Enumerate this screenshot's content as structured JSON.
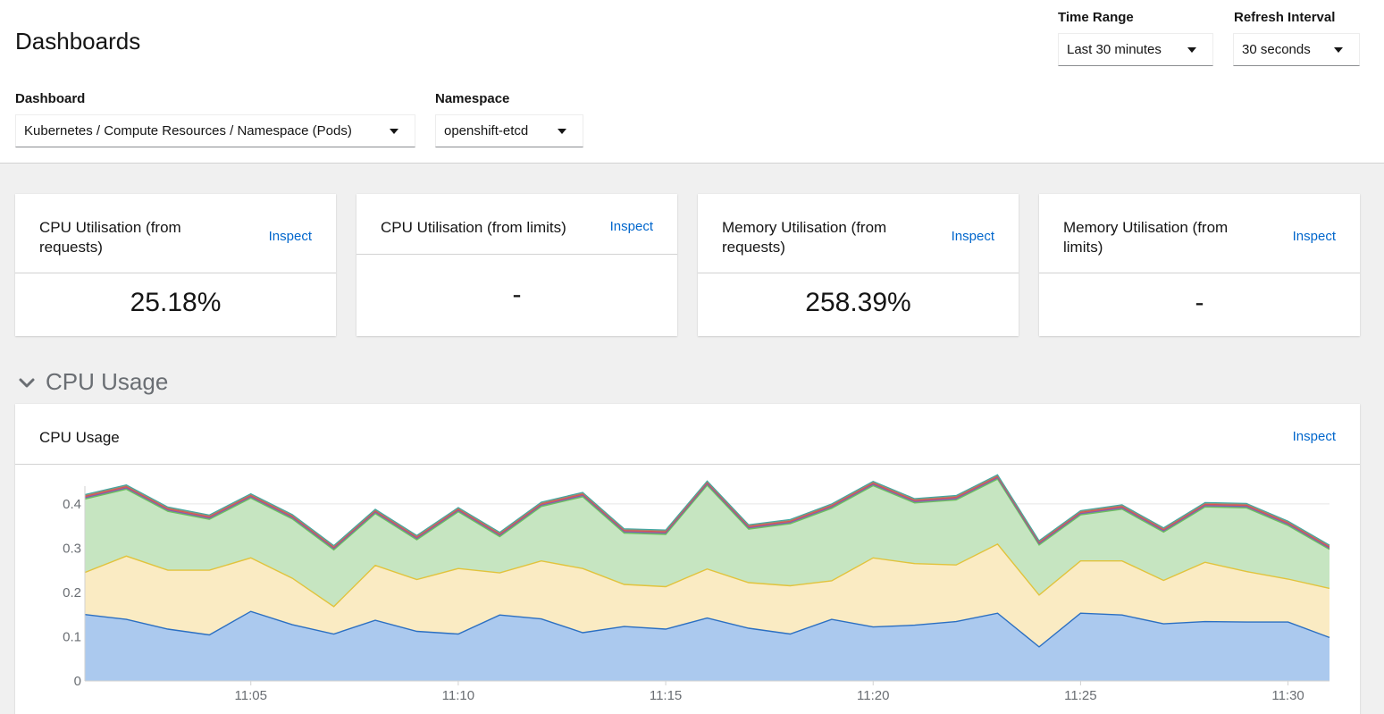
{
  "header": {
    "title": "Dashboards",
    "time_range": {
      "label": "Time Range",
      "value": "Last 30 minutes"
    },
    "refresh_interval": {
      "label": "Refresh Interval",
      "value": "30 seconds"
    },
    "dashboard": {
      "label": "Dashboard",
      "value": "Kubernetes / Compute Resources / Namespace (Pods)"
    },
    "namespace": {
      "label": "Namespace",
      "value": "openshift-etcd"
    }
  },
  "cards": [
    {
      "title": "CPU Utilisation (from requests)",
      "inspect": "Inspect",
      "value": "25.18%"
    },
    {
      "title": "CPU Utilisation (from limits)",
      "inspect": "Inspect",
      "value": "-"
    },
    {
      "title": "Memory Utilisation (from requests)",
      "inspect": "Inspect",
      "value": "258.39%"
    },
    {
      "title": "Memory Utilisation (from limits)",
      "inspect": "Inspect",
      "value": "-"
    }
  ],
  "section": {
    "title": "CPU Usage",
    "expanded": true,
    "icon": "chevron-down-icon"
  },
  "chart_panel": {
    "title": "CPU Usage",
    "inspect": "Inspect"
  },
  "chart_data": {
    "type": "area",
    "stacked": true,
    "title": "CPU Usage",
    "xlabel": "",
    "ylabel": "",
    "ylim": [
      0,
      0.44
    ],
    "yticks": [
      0,
      0.1,
      0.2,
      0.3,
      0.4
    ],
    "ytick_labels": [
      "0",
      "0.1",
      "0.2",
      "0.3",
      "0.4"
    ],
    "x_start": "11:01",
    "x_end": "11:31",
    "xtick_labels": [
      "11:05",
      "11:10",
      "11:15",
      "11:20",
      "11:25",
      "11:30"
    ],
    "xtick_values": [
      "11:05",
      "11:10",
      "11:15",
      "11:20",
      "11:25",
      "11:30"
    ],
    "x": [
      "11:01",
      "11:02",
      "11:03",
      "11:04",
      "11:05",
      "11:06",
      "11:07",
      "11:08",
      "11:09",
      "11:10",
      "11:11",
      "11:12",
      "11:13",
      "11:14",
      "11:15",
      "11:16",
      "11:17",
      "11:18",
      "11:19",
      "11:20",
      "11:21",
      "11:22",
      "11:23",
      "11:24",
      "11:25",
      "11:26",
      "11:27",
      "11:28",
      "11:29",
      "11:30",
      "11:31"
    ],
    "grid": true,
    "legend": "none",
    "series": [
      {
        "color": "#2b6fc2",
        "fill": "#abc9ee",
        "values": [
          0.15,
          0.139,
          0.117,
          0.104,
          0.157,
          0.127,
          0.106,
          0.137,
          0.112,
          0.106,
          0.149,
          0.14,
          0.109,
          0.123,
          0.117,
          0.142,
          0.119,
          0.106,
          0.139,
          0.122,
          0.126,
          0.134,
          0.153,
          0.077,
          0.153,
          0.149,
          0.129,
          0.134,
          0.133,
          0.133,
          0.098
        ]
      },
      {
        "color": "#e1c33c",
        "fill": "#faebc3",
        "values": [
          0.095,
          0.143,
          0.133,
          0.146,
          0.121,
          0.105,
          0.062,
          0.124,
          0.117,
          0.148,
          0.095,
          0.131,
          0.145,
          0.095,
          0.096,
          0.111,
          0.103,
          0.109,
          0.087,
          0.156,
          0.139,
          0.128,
          0.156,
          0.117,
          0.118,
          0.122,
          0.098,
          0.134,
          0.114,
          0.097,
          0.111
        ]
      },
      {
        "color": "#6cbf5f",
        "fill": "#c6e5c1",
        "values": [
          0.166,
          0.151,
          0.133,
          0.115,
          0.135,
          0.134,
          0.128,
          0.117,
          0.09,
          0.128,
          0.082,
          0.123,
          0.162,
          0.116,
          0.118,
          0.189,
          0.121,
          0.14,
          0.164,
          0.163,
          0.137,
          0.147,
          0.147,
          0.113,
          0.104,
          0.117,
          0.109,
          0.125,
          0.144,
          0.121,
          0.088
        ]
      },
      {
        "color": "#7d5db1",
        "fill": "#7d5db1",
        "values": [
          0.003,
          0.003,
          0.003,
          0.003,
          0.003,
          0.003,
          0.003,
          0.003,
          0.003,
          0.003,
          0.003,
          0.003,
          0.003,
          0.003,
          0.003,
          0.003,
          0.003,
          0.003,
          0.003,
          0.003,
          0.003,
          0.003,
          0.003,
          0.003,
          0.003,
          0.003,
          0.003,
          0.003,
          0.003,
          0.003,
          0.003
        ]
      },
      {
        "color": "#d9534f",
        "fill": "#d9534f",
        "values": [
          0.003,
          0.003,
          0.003,
          0.003,
          0.003,
          0.003,
          0.003,
          0.003,
          0.003,
          0.003,
          0.003,
          0.003,
          0.003,
          0.003,
          0.003,
          0.003,
          0.003,
          0.003,
          0.003,
          0.003,
          0.003,
          0.003,
          0.003,
          0.003,
          0.003,
          0.003,
          0.003,
          0.003,
          0.003,
          0.003,
          0.003
        ]
      },
      {
        "color": "#9e8b73",
        "fill": "#9e8b73",
        "values": [
          0.002,
          0.002,
          0.002,
          0.002,
          0.002,
          0.002,
          0.002,
          0.002,
          0.002,
          0.002,
          0.002,
          0.002,
          0.002,
          0.002,
          0.002,
          0.002,
          0.002,
          0.002,
          0.002,
          0.002,
          0.002,
          0.002,
          0.002,
          0.002,
          0.002,
          0.002,
          0.002,
          0.002,
          0.002,
          0.002,
          0.002
        ]
      },
      {
        "color": "#3fa7a2",
        "fill": "#3fa7a2",
        "values": [
          0.002,
          0.002,
          0.002,
          0.002,
          0.002,
          0.002,
          0.002,
          0.002,
          0.002,
          0.002,
          0.002,
          0.002,
          0.002,
          0.002,
          0.002,
          0.002,
          0.002,
          0.002,
          0.002,
          0.002,
          0.002,
          0.002,
          0.002,
          0.002,
          0.002,
          0.002,
          0.002,
          0.002,
          0.002,
          0.002,
          0.002
        ]
      }
    ]
  }
}
